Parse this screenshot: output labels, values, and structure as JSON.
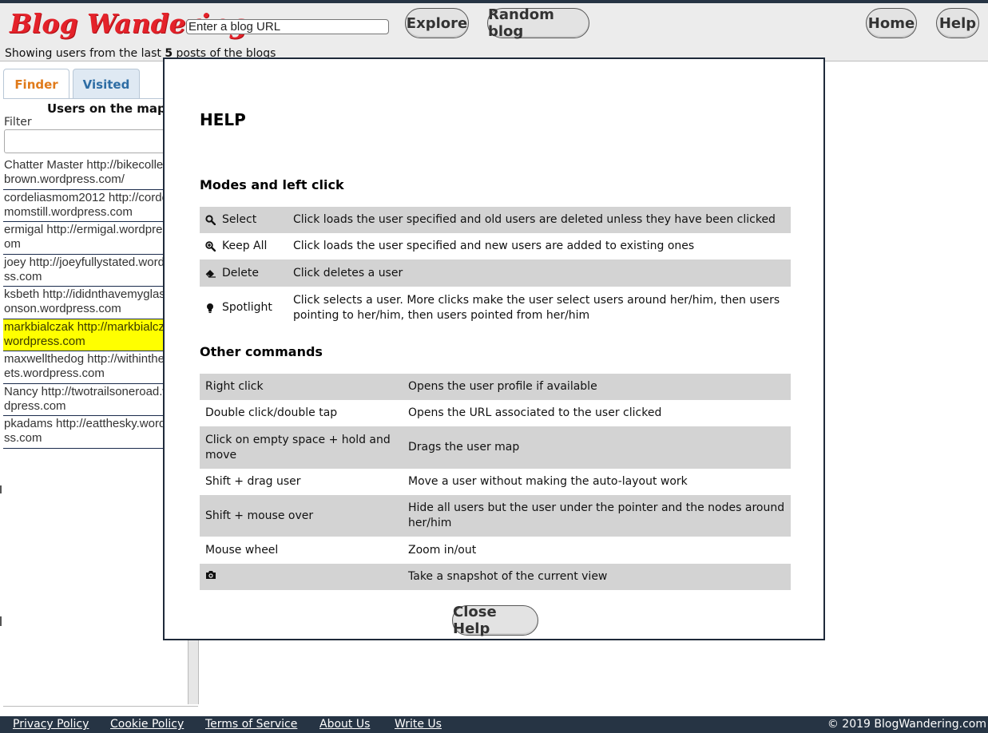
{
  "header": {
    "logo": "Blog Wandering",
    "url_placeholder": "Enter a blog URL",
    "explore_label": "Explore",
    "random_label": "Random blog",
    "home_label": "Home",
    "help_label": "Help",
    "showing_prefix": "Showing users from the last",
    "showing_count": "5",
    "showing_suffix": "posts of the blogs"
  },
  "sidebar": {
    "tabs": [
      {
        "label": "Finder",
        "active": true
      },
      {
        "label": "Visited",
        "active": false
      }
    ],
    "title": "Users on the map",
    "filter_label": "Filter",
    "filter_value": "",
    "users": [
      {
        "text": "Chatter Master http://bikecollectorbrown.wordpress.com/",
        "highlighted": false
      },
      {
        "text": "cordeliasmom2012 http://cordeliasmomstill.wordpress.com",
        "highlighted": false
      },
      {
        "text": "ermigal http://ermigal.wordpress.com",
        "highlighted": false
      },
      {
        "text": "joey http://joeyfullystated.wordpress.com",
        "highlighted": false
      },
      {
        "text": "ksbeth http://ididnthavemyglassesonson.wordpress.com",
        "highlighted": false
      },
      {
        "text": "markbialczak http://markbialczak.wordpress.com",
        "highlighted": true
      },
      {
        "text": "maxwellthedog http://withinthestreets.wordpress.com",
        "highlighted": false
      },
      {
        "text": "Nancy http://twotrailsoneroad.wordpress.com",
        "highlighted": false
      },
      {
        "text": "pkadams http://eatthesky.wordpress.com",
        "highlighted": false
      }
    ]
  },
  "help": {
    "title": "HELP",
    "modes_title": "Modes and left click",
    "modes": [
      {
        "icon": "search-icon",
        "name": "Select",
        "desc": "Click loads the user specified and old users are deleted unless they have been clicked"
      },
      {
        "icon": "zoom-plus-icon",
        "name": "Keep All",
        "desc": "Click loads the user specified and new users are added to existing ones"
      },
      {
        "icon": "eraser-icon",
        "name": "Delete",
        "desc": "Click deletes a user"
      },
      {
        "icon": "lightbulb-icon",
        "name": "Spotlight",
        "desc": "Click selects a user. More clicks make the user select users around her/him, then users pointing to her/him, then users pointed from her/him"
      }
    ],
    "other_title": "Other commands",
    "commands": [
      {
        "action": "Right click",
        "desc": "Opens the user profile if available"
      },
      {
        "action": "Double click/double tap",
        "desc": "Opens the URL associated to the user clicked"
      },
      {
        "action": "Click on empty space + hold and move",
        "desc": "Drags the user map"
      },
      {
        "action": "Shift + drag user",
        "desc": "Move a user without making the auto-layout work"
      },
      {
        "action": "Shift + mouse over",
        "desc": "Hide all users but the user under the pointer and the nodes around her/him"
      },
      {
        "action": "Mouse wheel",
        "desc": "Zoom in/out"
      },
      {
        "action": "",
        "icon": "camera-icon",
        "desc": "Take a snapshot of the current view"
      }
    ],
    "close_label": "Close Help"
  },
  "footer": {
    "links": [
      "Privacy Policy",
      "Cookie Policy",
      "Terms of Service",
      "About Us",
      "Write Us"
    ],
    "copyright": "© 2019 BlogWandering.com"
  },
  "colors": {
    "logo": "#e4222a",
    "highlight": "#ffff00",
    "footer_bg": "#263444",
    "finder_tab": "#e07a1a",
    "visited_tab": "#2e6da4"
  }
}
